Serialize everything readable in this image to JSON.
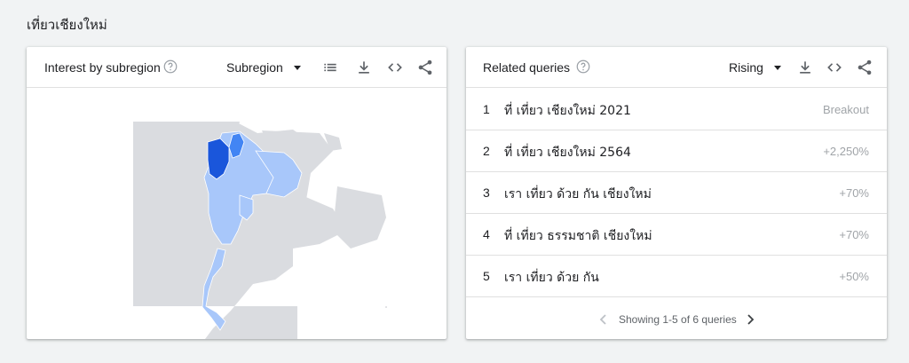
{
  "page": {
    "title": "เที่ยวเชียงใหม่"
  },
  "subregion_card": {
    "title": "Interest by subregion",
    "dropdown_label": "Subregion",
    "icons": [
      "help-icon",
      "caret-down-icon",
      "list-icon",
      "download-icon",
      "embed-code-icon",
      "share-icon"
    ]
  },
  "queries_card": {
    "title": "Related queries",
    "dropdown_label": "Rising",
    "icons": [
      "help-icon",
      "caret-down-icon",
      "download-icon",
      "embed-code-icon",
      "share-icon"
    ],
    "rows": [
      {
        "rank": "1",
        "query": "ที่ เที่ยว เชียงใหม่ 2021",
        "value": "Breakout"
      },
      {
        "rank": "2",
        "query": "ที่ เที่ยว เชียงใหม่ 2564",
        "value": "+2,250%"
      },
      {
        "rank": "3",
        "query": "เรา เที่ยว ด้วย กัน เชียงใหม่",
        "value": "+70%"
      },
      {
        "rank": "4",
        "query": "ที่ เที่ยว ธรรมชาติ เชียงใหม่",
        "value": "+70%"
      },
      {
        "rank": "5",
        "query": "เรา เที่ยว ด้วย กัน",
        "value": "+50%"
      }
    ],
    "pager": {
      "text": "Showing 1-5 of 6 queries"
    }
  },
  "colors": {
    "background": "#f1f3f4",
    "map_land": "#dadce0",
    "map_light_blue": "#a8c7fa",
    "map_mid_blue": "#4285f4",
    "map_dark_blue": "#1a56db"
  }
}
